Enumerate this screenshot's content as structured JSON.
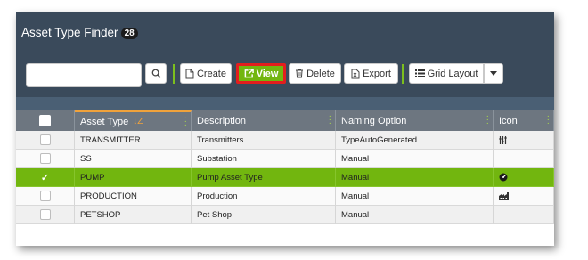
{
  "header": {
    "title": "Asset Type Finder",
    "count": "28"
  },
  "search": {
    "placeholder": ""
  },
  "toolbar": {
    "create_label": "Create",
    "view_label": "View",
    "delete_label": "Delete",
    "export_label": "Export",
    "grid_layout_label": "Grid Layout"
  },
  "columns": {
    "asset_type": "Asset Type",
    "sort_indicator": "↓Z",
    "description": "Description",
    "naming_option": "Naming Option",
    "icon": "Icon"
  },
  "rows": [
    {
      "asset_type": "TRANSMITTER",
      "description": "Transmitters",
      "naming_option": "TypeAutoGenerated",
      "icon": "transmitter-icon"
    },
    {
      "asset_type": "SS",
      "description": "Substation",
      "naming_option": "Manual",
      "icon": ""
    },
    {
      "asset_type": "PUMP",
      "description": "Pump Asset Type",
      "naming_option": "Manual",
      "icon": "pump-icon",
      "selected": true
    },
    {
      "asset_type": "PRODUCTION",
      "description": "Production",
      "naming_option": "Manual",
      "icon": "production-icon"
    },
    {
      "asset_type": "PETSHOP",
      "description": "Pet Shop",
      "naming_option": "Manual",
      "icon": ""
    }
  ],
  "colors": {
    "header_bg": "#3a4a5b",
    "accent_green": "#72b60f",
    "highlight_red": "#e31e1e",
    "sort_orange": "#f0a23b"
  }
}
